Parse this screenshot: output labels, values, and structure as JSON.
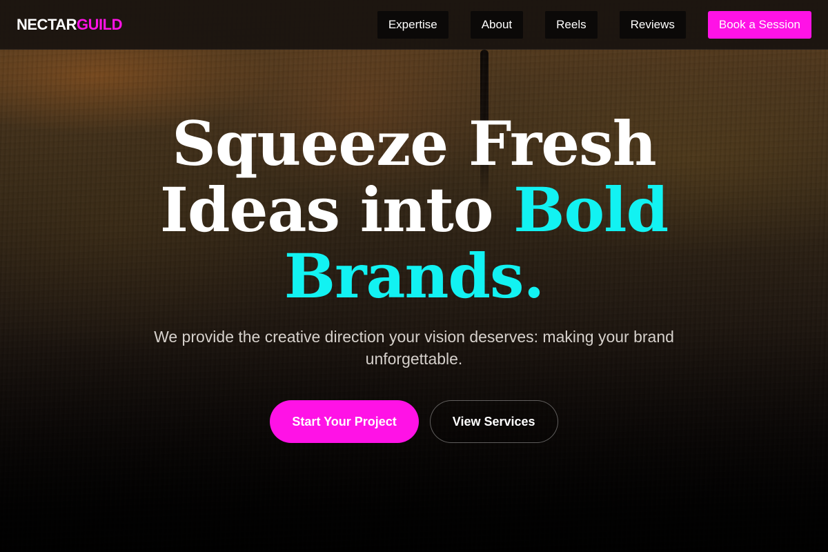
{
  "brand": {
    "logo_part1": "NECTAR",
    "logo_part2": "GUILD",
    "accent_color": "#ff12e6",
    "highlight_color": "#12f2f2"
  },
  "nav": {
    "links": [
      {
        "label": "Expertise"
      },
      {
        "label": "About"
      },
      {
        "label": "Reels"
      },
      {
        "label": "Reviews"
      }
    ],
    "cta_label": "Book a Session"
  },
  "hero": {
    "headline_line1": "Squeeze Fresh",
    "headline_line2_plain": "Ideas into ",
    "headline_line2_accent": "Bold",
    "headline_line3_accent": "Brands.",
    "subtitle": "We provide the creative direction your vision deserves: making your brand unforgettable.",
    "primary_button": "Start Your Project",
    "secondary_button": "View Services"
  }
}
